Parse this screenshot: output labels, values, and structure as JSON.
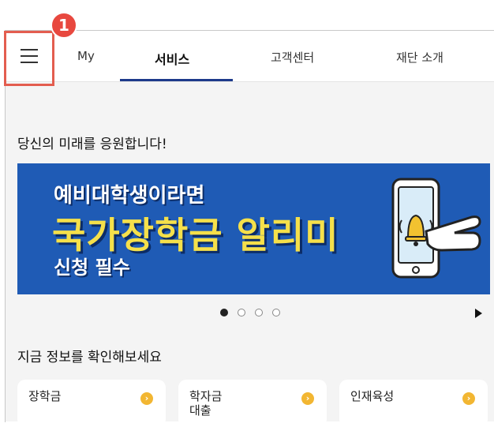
{
  "annotation": {
    "step_number": "1"
  },
  "nav": {
    "tabs": [
      {
        "label": "My"
      },
      {
        "label": "서비스"
      },
      {
        "label": "고객센터"
      },
      {
        "label": "재단 소개"
      }
    ],
    "active_tab": "서비스"
  },
  "main": {
    "headline": "당신의 미래를 응원합니다!",
    "banner": {
      "line1": "예비대학생이라면",
      "line2": "국가장학금 알리미",
      "line3": "신청 필수",
      "icon": "bell-phone-icon"
    },
    "carousel": {
      "count": 4,
      "active_index": 0
    },
    "section_title": "지금 정보를 확인해보세요",
    "cards": [
      {
        "label": "장학금"
      },
      {
        "label": "학자금\n대출"
      },
      {
        "label": "인재육성"
      }
    ]
  },
  "colors": {
    "accent": "#1d3a8a",
    "banner": "#1f5bb5",
    "highlight": "#e35d4f",
    "arrow": "#f2b632"
  }
}
